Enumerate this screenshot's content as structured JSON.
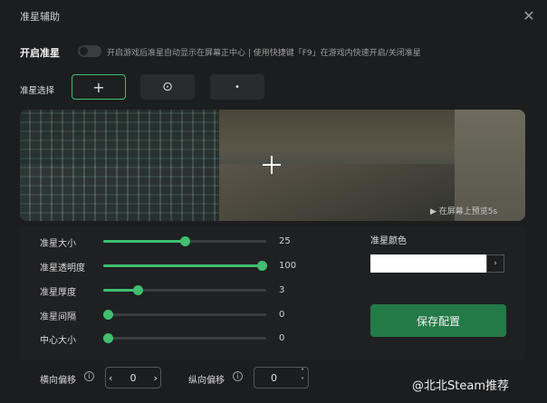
{
  "window": {
    "title": "准星辅助",
    "close_icon": "close-icon"
  },
  "enable": {
    "label": "开启准星",
    "enabled": false,
    "description": "开启游戏后准星自动显示在屏幕正中心 | 使用快捷键「F9」在游戏内快速开启/关闭准星"
  },
  "crosshair_select": {
    "label": "准星选择",
    "options": [
      {
        "icon": "plus-crosshair-icon",
        "glyph": "+",
        "selected": true
      },
      {
        "icon": "circle-dot-crosshair-icon",
        "glyph": "⊙",
        "selected": false
      },
      {
        "icon": "dot-crosshair-icon",
        "glyph": "•",
        "selected": false
      }
    ]
  },
  "preview": {
    "note": "▶ 在屏幕上预览5s"
  },
  "sliders": [
    {
      "label": "准星大小",
      "value": "25",
      "fraction": 0.5
    },
    {
      "label": "准星透明度",
      "value": "100",
      "fraction": 0.97
    },
    {
      "label": "准星厚度",
      "value": "3",
      "fraction": 0.21
    },
    {
      "label": "准星间隔",
      "value": "0",
      "fraction": 0.03
    },
    {
      "label": "中心大小",
      "value": "0",
      "fraction": 0.03
    }
  ],
  "color": {
    "label": "准星颜色",
    "value": "#ffffff",
    "button_glyph": "›"
  },
  "save_button": {
    "label": "保存配置"
  },
  "offsets": {
    "horizontal": {
      "label": "横向偏移",
      "value": "0",
      "left_glyph": "‹",
      "right_glyph": "›"
    },
    "vertical": {
      "label": "纵向偏移",
      "value": "0",
      "up_glyph": "˄",
      "down_glyph": "˅"
    }
  },
  "info_glyph": "i",
  "watermark": "@北北Steam推荐",
  "colors": {
    "accent": "#3fbf6f",
    "save_bg": "#237a47",
    "background": "#1c1d1f"
  }
}
